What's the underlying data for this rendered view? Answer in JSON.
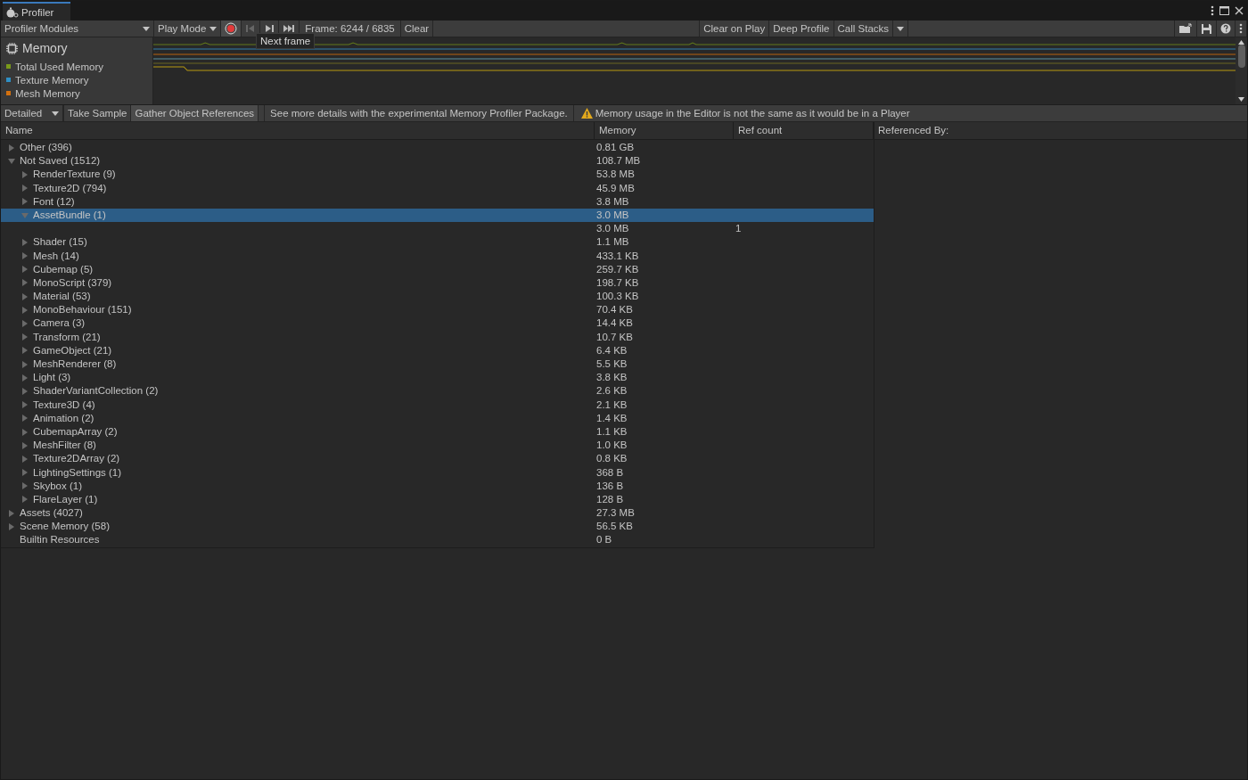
{
  "window": {
    "title": "Profiler"
  },
  "toolbar": {
    "modules_dropdown": "Profiler Modules",
    "target_dropdown": "Play Mode",
    "recording": true,
    "frame": "Frame: 6244 / 6835",
    "clear": "Clear",
    "clear_on_play": "Clear on Play",
    "deep_profile": "Deep Profile",
    "call_stacks": "Call Stacks"
  },
  "tooltip": "Next frame",
  "module": {
    "title": "Memory",
    "legend": [
      {
        "label": "Total Used Memory",
        "color": "#7a9a1a"
      },
      {
        "label": "Texture Memory",
        "color": "#2f8fc4"
      },
      {
        "label": "Mesh Memory",
        "color": "#d2700f"
      }
    ]
  },
  "detail_toolbar": {
    "view_dropdown": "Detailed",
    "take_sample": "Take Sample",
    "gather_references": {
      "label": "Gather Object References",
      "on": true
    },
    "info": "See more details with the experimental Memory Profiler Package.",
    "warning": "Memory usage in the Editor is not the same as it would be in a Player"
  },
  "table": {
    "columns": [
      "Name",
      "Memory",
      "Ref count"
    ],
    "rows": [
      {
        "name": "Other (396)",
        "memory": "0.81 GB",
        "expanded": false,
        "selected": false
      },
      {
        "name": "Not Saved (1512)",
        "memory": "108.7 MB",
        "expanded": true,
        "selected": false,
        "children": [
          {
            "name": "RenderTexture (9)",
            "memory": "53.8 MB",
            "expanded": false,
            "selected": false
          },
          {
            "name": "Texture2D (794)",
            "memory": "45.9 MB",
            "expanded": false,
            "selected": false
          },
          {
            "name": "Font (12)",
            "memory": "3.8 MB",
            "expanded": false,
            "selected": false
          },
          {
            "name": "AssetBundle (1)",
            "memory": "3.0 MB",
            "expanded": true,
            "selected": true,
            "children": [
              {
                "memory": "3.0 MB",
                "ref_count": "1",
                "selected": false
              }
            ]
          },
          {
            "name": "Shader (15)",
            "memory": "1.1 MB",
            "expanded": false,
            "selected": false
          },
          {
            "name": "Mesh (14)",
            "memory": "433.1 KB",
            "expanded": false,
            "selected": false
          },
          {
            "name": "Cubemap (5)",
            "memory": "259.7 KB",
            "expanded": false,
            "selected": false
          },
          {
            "name": "MonoScript (379)",
            "memory": "198.7 KB",
            "expanded": false,
            "selected": false
          },
          {
            "name": "Material (53)",
            "memory": "100.3 KB",
            "expanded": false,
            "selected": false
          },
          {
            "name": "MonoBehaviour (151)",
            "memory": "70.4 KB",
            "expanded": false,
            "selected": false
          },
          {
            "name": "Camera (3)",
            "memory": "14.4 KB",
            "expanded": false,
            "selected": false
          },
          {
            "name": "Transform (21)",
            "memory": "10.7 KB",
            "expanded": false,
            "selected": false
          },
          {
            "name": "GameObject (21)",
            "memory": "6.4 KB",
            "expanded": false,
            "selected": false
          },
          {
            "name": "MeshRenderer (8)",
            "memory": "5.5 KB",
            "expanded": false,
            "selected": false
          },
          {
            "name": "Light (3)",
            "memory": "3.8 KB",
            "expanded": false,
            "selected": false
          },
          {
            "name": "ShaderVariantCollection (2)",
            "memory": "2.6 KB",
            "expanded": false,
            "selected": false
          },
          {
            "name": "Texture3D (4)",
            "memory": "2.1 KB",
            "expanded": false,
            "selected": false
          },
          {
            "name": "Animation (2)",
            "memory": "1.4 KB",
            "expanded": false,
            "selected": false
          },
          {
            "name": "CubemapArray (2)",
            "memory": "1.1 KB",
            "expanded": false,
            "selected": false
          },
          {
            "name": "MeshFilter (8)",
            "memory": "1.0 KB",
            "expanded": false,
            "selected": false
          },
          {
            "name": "Texture2DArray (2)",
            "memory": "0.8 KB",
            "expanded": false,
            "selected": false
          },
          {
            "name": "LightingSettings (1)",
            "memory": "368 B",
            "expanded": false,
            "selected": false
          },
          {
            "name": "Skybox (1)",
            "memory": "136 B",
            "expanded": false,
            "selected": false
          },
          {
            "name": "FlareLayer (1)",
            "memory": "128 B",
            "expanded": false,
            "selected": false
          }
        ]
      },
      {
        "name": "Assets (4027)",
        "memory": "27.3 MB",
        "expanded": false,
        "selected": false
      },
      {
        "name": "Scene Memory (58)",
        "memory": "56.5 KB",
        "expanded": false,
        "selected": false
      },
      {
        "name": "Builtin Resources",
        "memory": "0 B",
        "selected": false
      }
    ]
  },
  "references": {
    "title": "Referenced By:"
  }
}
